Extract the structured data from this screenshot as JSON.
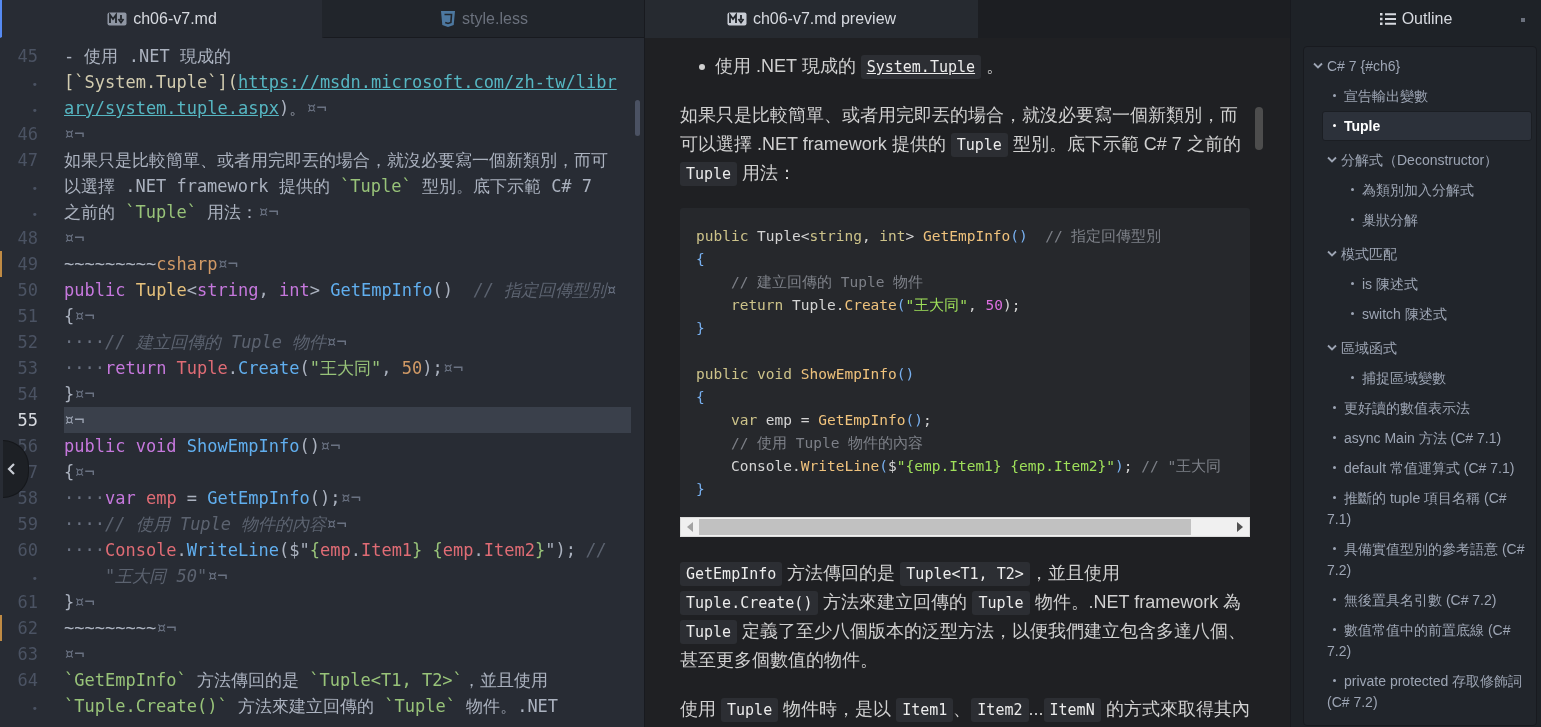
{
  "editor": {
    "tabs": [
      {
        "label": "ch06-v7.md",
        "selected": true
      },
      {
        "label": "style.less",
        "selected": false
      }
    ],
    "lines": [
      {
        "number": "45",
        "kind": "line",
        "current": false,
        "modified": false,
        "tokens": [
          {
            "text": "- 使用 .NET 現成的",
            "kind": "plain"
          }
        ]
      },
      {
        "number": "•",
        "kind": "wrap",
        "current": false,
        "modified": false,
        "tokens": [
          {
            "text": "[`System.Tuple`](",
            "kind": "linktext"
          },
          {
            "text": "https://msdn.microsoft.com/zh-tw/libr",
            "kind": "link"
          }
        ]
      },
      {
        "number": "•",
        "kind": "wrap",
        "current": false,
        "modified": false,
        "tokens": [
          {
            "text": "ary/system.tuple.aspx",
            "kind": "link"
          },
          {
            "text": ")。",
            "kind": "plain"
          },
          {
            "text": "¤¬",
            "kind": "eol"
          }
        ]
      },
      {
        "number": "46",
        "kind": "line",
        "current": false,
        "modified": false,
        "tokens": [
          {
            "text": "¤¬",
            "kind": "eol"
          }
        ]
      },
      {
        "number": "47",
        "kind": "line",
        "current": false,
        "modified": false,
        "tokens": [
          {
            "text": "如果只是比較簡單、或者用完即丟的場合，就沒必要寫一個新類別，而可",
            "kind": "plain"
          }
        ]
      },
      {
        "number": "•",
        "kind": "wrap",
        "current": false,
        "modified": false,
        "tokens": [
          {
            "text": "以選擇 .NET framework 提供的 ",
            "kind": "plain"
          },
          {
            "text": "`Tuple`",
            "kind": "code"
          },
          {
            "text": " 型別。底下示範 C# 7",
            "kind": "plain"
          }
        ]
      },
      {
        "number": "•",
        "kind": "wrap",
        "current": false,
        "modified": false,
        "tokens": [
          {
            "text": "之前的 ",
            "kind": "plain"
          },
          {
            "text": "`Tuple`",
            "kind": "code"
          },
          {
            "text": " 用法：",
            "kind": "plain"
          },
          {
            "text": "¤¬",
            "kind": "eol"
          }
        ]
      },
      {
        "number": "48",
        "kind": "line",
        "current": false,
        "modified": false,
        "tokens": [
          {
            "text": "¤¬",
            "kind": "eol"
          }
        ]
      },
      {
        "number": "49",
        "kind": "line",
        "current": false,
        "modified": true,
        "tokens": [
          {
            "text": "~~~~~~~~~",
            "kind": "plain"
          },
          {
            "text": "csharp",
            "kind": "num"
          },
          {
            "text": "¤¬",
            "kind": "eol"
          }
        ]
      },
      {
        "number": "50",
        "kind": "line",
        "current": false,
        "modified": false,
        "tokens": [
          {
            "text": "public ",
            "kind": "kw"
          },
          {
            "text": "Tuple",
            "kind": "type"
          },
          {
            "text": "<",
            "kind": "plain"
          },
          {
            "text": "string",
            "kind": "kw"
          },
          {
            "text": ", ",
            "kind": "plain"
          },
          {
            "text": "int",
            "kind": "kw"
          },
          {
            "text": "> ",
            "kind": "plain"
          },
          {
            "text": "GetEmpInfo",
            "kind": "fn"
          },
          {
            "text": "()  ",
            "kind": "plain"
          },
          {
            "text": "// 指定回傳型別",
            "kind": "comment"
          },
          {
            "text": "¤",
            "kind": "eol"
          }
        ]
      },
      {
        "number": "51",
        "kind": "line",
        "current": false,
        "modified": false,
        "tokens": [
          {
            "text": "{",
            "kind": "plain"
          },
          {
            "text": "¤¬",
            "kind": "eol"
          }
        ]
      },
      {
        "number": "52",
        "kind": "line",
        "current": false,
        "modified": false,
        "tokens": [
          {
            "text": "····",
            "kind": "ws"
          },
          {
            "text": "// 建立回傳的 Tuple 物件",
            "kind": "comment"
          },
          {
            "text": "¤¬",
            "kind": "eol"
          }
        ]
      },
      {
        "number": "53",
        "kind": "line",
        "current": false,
        "modified": false,
        "tokens": [
          {
            "text": "····",
            "kind": "ws"
          },
          {
            "text": "return ",
            "kind": "kw"
          },
          {
            "text": "Tuple",
            "kind": "var"
          },
          {
            "text": ".",
            "kind": "plain"
          },
          {
            "text": "Create",
            "kind": "fn"
          },
          {
            "text": "(",
            "kind": "plain"
          },
          {
            "text": "\"王大同\"",
            "kind": "str"
          },
          {
            "text": ", ",
            "kind": "plain"
          },
          {
            "text": "50",
            "kind": "num"
          },
          {
            "text": ");",
            "kind": "plain"
          },
          {
            "text": "¤¬",
            "kind": "eol"
          }
        ]
      },
      {
        "number": "54",
        "kind": "line",
        "current": false,
        "modified": false,
        "tokens": [
          {
            "text": "}",
            "kind": "plain"
          },
          {
            "text": "¤¬",
            "kind": "eol"
          }
        ]
      },
      {
        "number": "55",
        "kind": "line",
        "current": true,
        "modified": false,
        "tokens": [
          {
            "text": "¤¬",
            "kind": "eol"
          }
        ]
      },
      {
        "number": "56",
        "kind": "line",
        "current": false,
        "modified": false,
        "tokens": [
          {
            "text": "public void ",
            "kind": "kw"
          },
          {
            "text": "ShowEmpInfo",
            "kind": "fn"
          },
          {
            "text": "()",
            "kind": "plain"
          },
          {
            "text": "¤¬",
            "kind": "eol"
          }
        ]
      },
      {
        "number": "7",
        "kind": "line",
        "current": false,
        "modified": false,
        "tokens": [
          {
            "text": "{",
            "kind": "plain"
          },
          {
            "text": "¤¬",
            "kind": "eol"
          }
        ]
      },
      {
        "number": "58",
        "kind": "line",
        "current": false,
        "modified": false,
        "tokens": [
          {
            "text": "····",
            "kind": "ws"
          },
          {
            "text": "var ",
            "kind": "kw"
          },
          {
            "text": "emp",
            "kind": "var"
          },
          {
            "text": " = ",
            "kind": "plain"
          },
          {
            "text": "GetEmpInfo",
            "kind": "fn"
          },
          {
            "text": "();",
            "kind": "plain"
          },
          {
            "text": "¤¬",
            "kind": "eol"
          }
        ]
      },
      {
        "number": "59",
        "kind": "line",
        "current": false,
        "modified": false,
        "tokens": [
          {
            "text": "····",
            "kind": "ws"
          },
          {
            "text": "// 使用 Tuple 物件的內容",
            "kind": "comment"
          },
          {
            "text": "¤¬",
            "kind": "eol"
          }
        ]
      },
      {
        "number": "60",
        "kind": "line",
        "current": false,
        "modified": false,
        "tokens": [
          {
            "text": "····",
            "kind": "ws"
          },
          {
            "text": "Console",
            "kind": "var"
          },
          {
            "text": ".",
            "kind": "plain"
          },
          {
            "text": "WriteLine",
            "kind": "fn"
          },
          {
            "text": "($\"",
            "kind": "plain"
          },
          {
            "text": "{",
            "kind": "str"
          },
          {
            "text": "emp",
            "kind": "var"
          },
          {
            "text": ".",
            "kind": "plain"
          },
          {
            "text": "Item1",
            "kind": "var"
          },
          {
            "text": "} {",
            "kind": "str"
          },
          {
            "text": "emp",
            "kind": "var"
          },
          {
            "text": ".",
            "kind": "plain"
          },
          {
            "text": "Item2",
            "kind": "var"
          },
          {
            "text": "}",
            "kind": "str"
          },
          {
            "text": "\"); ",
            "kind": "plain"
          },
          {
            "text": "//",
            "kind": "comment"
          }
        ]
      },
      {
        "number": "•",
        "kind": "wrap",
        "current": false,
        "modified": false,
        "tokens": [
          {
            "text": "    \"王大同 50\"",
            "kind": "comment"
          },
          {
            "text": "¤¬",
            "kind": "eol"
          }
        ]
      },
      {
        "number": "61",
        "kind": "line",
        "current": false,
        "modified": false,
        "tokens": [
          {
            "text": "}",
            "kind": "plain"
          },
          {
            "text": "¤¬",
            "kind": "eol"
          }
        ]
      },
      {
        "number": "62",
        "kind": "line",
        "current": false,
        "modified": true,
        "tokens": [
          {
            "text": "~~~~~~~~~",
            "kind": "plain"
          },
          {
            "text": "¤¬",
            "kind": "eol"
          }
        ]
      },
      {
        "number": "63",
        "kind": "line",
        "current": false,
        "modified": false,
        "tokens": [
          {
            "text": "¤¬",
            "kind": "eol"
          }
        ]
      },
      {
        "number": "64",
        "kind": "line",
        "current": false,
        "modified": false,
        "tokens": [
          {
            "text": "`GetEmpInfo`",
            "kind": "code"
          },
          {
            "text": " 方法傳回的是 ",
            "kind": "plain"
          },
          {
            "text": "`Tuple<T1, T2>`",
            "kind": "code"
          },
          {
            "text": "，並且使用",
            "kind": "plain"
          }
        ]
      },
      {
        "number": "•",
        "kind": "wrap",
        "current": false,
        "modified": false,
        "tokens": [
          {
            "text": "`Tuple.Create()`",
            "kind": "code"
          },
          {
            "text": " 方法來建立回傳的 ",
            "kind": "plain"
          },
          {
            "text": "`Tuple`",
            "kind": "code"
          },
          {
            "text": " 物件。.NET",
            "kind": "plain"
          }
        ]
      }
    ]
  },
  "preview": {
    "tab": {
      "label": "ch06-v7.md preview",
      "selected": true
    },
    "blocks": [
      {
        "kind": "bullet",
        "tokens": [
          {
            "text": "使用 .NET 現成的 ",
            "kind": "text"
          },
          {
            "text": "System.Tuple",
            "kind": "link"
          },
          {
            "text": " 。",
            "kind": "text"
          }
        ]
      },
      {
        "kind": "paragraph",
        "tokens": [
          {
            "text": "如果只是比較簡單、或者用完即丟的場合，就沒必要寫一個新類別，而可以選擇 .NET framework 提供的 ",
            "kind": "text"
          },
          {
            "text": "Tuple",
            "kind": "code"
          },
          {
            "text": " 型別。底下示範 C# 7 之前的 ",
            "kind": "text"
          },
          {
            "text": "Tuple",
            "kind": "code"
          },
          {
            "text": " 用法：",
            "kind": "text"
          }
        ]
      },
      {
        "kind": "code",
        "lines": [
          {
            "tokens": [
              {
                "text": "public",
                "kind": "kw"
              },
              {
                "text": " Tuple<",
                "kind": "plain"
              },
              {
                "text": "string",
                "kind": "kw"
              },
              {
                "text": ", ",
                "kind": "plain"
              },
              {
                "text": "int",
                "kind": "kw"
              },
              {
                "text": "> ",
                "kind": "plain"
              },
              {
                "text": "GetEmpInfo",
                "kind": "fn"
              },
              {
                "text": "()",
                "kind": "punc"
              },
              {
                "text": "  // 指定回傳型別",
                "kind": "comment"
              }
            ]
          },
          {
            "tokens": [
              {
                "text": "{",
                "kind": "punc"
              }
            ]
          },
          {
            "tokens": [
              {
                "text": "    // 建立回傳的 Tuple 物件",
                "kind": "comment"
              }
            ]
          },
          {
            "tokens": [
              {
                "text": "    return",
                "kind": "kw"
              },
              {
                "text": " Tuple.",
                "kind": "plain"
              },
              {
                "text": "Create",
                "kind": "fn"
              },
              {
                "text": "(",
                "kind": "punc"
              },
              {
                "text": "\"王大同\"",
                "kind": "str"
              },
              {
                "text": ", ",
                "kind": "plain"
              },
              {
                "text": "50",
                "kind": "num"
              },
              {
                "text": ");",
                "kind": "plain"
              }
            ]
          },
          {
            "tokens": [
              {
                "text": "}",
                "kind": "punc"
              }
            ]
          },
          {
            "kind": "blank"
          },
          {
            "tokens": [
              {
                "text": "public void",
                "kind": "kw"
              },
              {
                "text": " ShowEmpInfo",
                "kind": "fn"
              },
              {
                "text": "()",
                "kind": "punc"
              }
            ]
          },
          {
            "tokens": [
              {
                "text": "{",
                "kind": "punc"
              }
            ]
          },
          {
            "tokens": [
              {
                "text": "    var",
                "kind": "kw"
              },
              {
                "text": " emp = ",
                "kind": "plain"
              },
              {
                "text": "GetEmpInfo",
                "kind": "fn"
              },
              {
                "text": "()",
                "kind": "punc"
              },
              {
                "text": ";",
                "kind": "plain"
              }
            ]
          },
          {
            "tokens": [
              {
                "text": "    // 使用 Tuple 物件的內容",
                "kind": "comment"
              }
            ]
          },
          {
            "tokens": [
              {
                "text": "    Console.",
                "kind": "plain"
              },
              {
                "text": "WriteLine",
                "kind": "fn"
              },
              {
                "text": "(",
                "kind": "punc"
              },
              {
                "text": "$",
                "kind": "plain"
              },
              {
                "text": "\"{emp.Item1} {emp.Item2}\"",
                "kind": "str"
              },
              {
                "text": ")",
                "kind": "punc"
              },
              {
                "text": "; ",
                "kind": "plain"
              },
              {
                "text": "// \"王大同",
                "kind": "comment"
              }
            ]
          },
          {
            "tokens": [
              {
                "text": "}",
                "kind": "punc"
              }
            ]
          }
        ]
      },
      {
        "kind": "paragraph",
        "tokens": [
          {
            "text": "GetEmpInfo",
            "kind": "code"
          },
          {
            "text": " 方法傳回的是 ",
            "kind": "text"
          },
          {
            "text": "Tuple<T1, T2>",
            "kind": "code"
          },
          {
            "text": "，並且使用 ",
            "kind": "text"
          },
          {
            "text": "Tuple.Create()",
            "kind": "code"
          },
          {
            "text": " 方法來建立回傳的 ",
            "kind": "text"
          },
          {
            "text": "Tuple",
            "kind": "code"
          },
          {
            "text": " 物件。.NET framework 為 ",
            "kind": "text"
          },
          {
            "text": "Tuple",
            "kind": "code"
          },
          {
            "text": " 定義了至少八個版本的泛型方法，以便我們建立包含多達八個、甚至更多個數值的物件。",
            "kind": "text"
          }
        ]
      },
      {
        "kind": "line",
        "tokens": [
          {
            "text": "使用 ",
            "kind": "text"
          },
          {
            "text": "Tuple",
            "kind": "code"
          },
          {
            "text": " 物件時，是以 ",
            "kind": "text"
          },
          {
            "text": "Item1",
            "kind": "code"
          },
          {
            "text": "、",
            "kind": "text"
          },
          {
            "text": "Item2",
            "kind": "code"
          },
          {
            "text": "...",
            "kind": "text"
          },
          {
            "text": "ItemN",
            "kind": "code"
          },
          {
            "text": " 的方式來取得其內",
            "kind": "text"
          }
        ]
      }
    ]
  },
  "outline": {
    "title": "Outline",
    "items": [
      {
        "label": "C# 7 {#ch6}",
        "selected": false,
        "expanded": true,
        "children": [
          {
            "label": "宣告輸出變數",
            "selected": false
          },
          {
            "label": "Tuple",
            "selected": true
          },
          {
            "label": "分解式（Deconstructor）",
            "selected": false,
            "expanded": true,
            "children": [
              {
                "label": "為類別加入分解式",
                "selected": false
              },
              {
                "label": "巢狀分解",
                "selected": false
              }
            ]
          },
          {
            "label": "模式匹配",
            "selected": false,
            "expanded": true,
            "children": [
              {
                "label": "is 陳述式",
                "selected": false
              },
              {
                "label": "switch 陳述式",
                "selected": false
              }
            ]
          },
          {
            "label": "區域函式",
            "selected": false,
            "expanded": true,
            "children": [
              {
                "label": "捕捉區域變數",
                "selected": false
              }
            ]
          },
          {
            "label": "更好讀的數值表示法",
            "selected": false
          },
          {
            "label": "async Main 方法 (C# 7.1)",
            "selected": false
          },
          {
            "label": "default 常值運算式 (C# 7.1)",
            "selected": false
          },
          {
            "label": "推斷的 tuple 項目名稱 (C# 7.1)",
            "selected": false
          },
          {
            "label": "具備實值型別的參考語意 (C# 7.2)",
            "selected": false
          },
          {
            "label": "無後置具名引數 (C# 7.2)",
            "selected": false
          },
          {
            "label": "數值常值中的前置底線 (C# 7.2)",
            "selected": false
          },
          {
            "label": "private protected 存取修飾詞 (C# 7.2)",
            "selected": false
          }
        ]
      }
    ]
  }
}
